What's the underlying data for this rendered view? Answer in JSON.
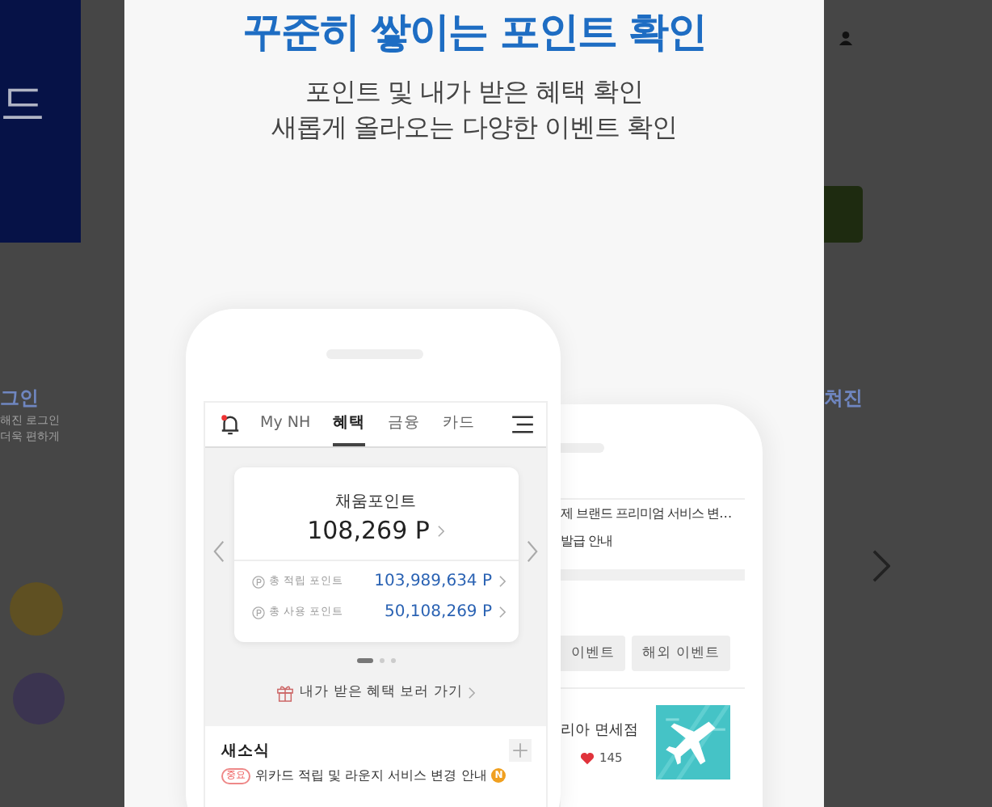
{
  "background_page": {
    "banner_text": "드",
    "left_heading": "그인",
    "left_lines": [
      "해진 로그인",
      "더욱 편하게"
    ],
    "right_heading": "쳐진"
  },
  "modal": {
    "title": "꾸준히 쌓이는 포인트 확인",
    "subtitle_lines": [
      "포인트 및 내가 받은 혜택 확인",
      "새롭게 올라오는 다양한 이벤트 확인"
    ]
  },
  "front_phone": {
    "nav_tabs": [
      {
        "label": "My NH",
        "selected": false
      },
      {
        "label": "혜택",
        "selected": true
      },
      {
        "label": "금융",
        "selected": false
      },
      {
        "label": "카드",
        "selected": false
      }
    ],
    "points": {
      "title": "채움포인트",
      "total": "108,269 P",
      "rows": [
        {
          "label": "총 적립 포인트",
          "value": "103,989,634 P"
        },
        {
          "label": "총 사용 포인트",
          "value": "50,108,269 P"
        }
      ]
    },
    "carousel_pages": [
      {
        "selected": true
      },
      {
        "selected": false
      },
      {
        "selected": false
      }
    ],
    "benefits_link": "내가 받은 혜택 보러 가기",
    "news": {
      "title": "새소식",
      "items": [
        {
          "tag": "중요",
          "text": "위카드 적립 및 라운지 서비스 변경 안내",
          "badge": "N"
        }
      ]
    }
  },
  "back_phone": {
    "notices": [
      "제 브랜드 프리미엄 서비스 변…",
      "발급 안내"
    ],
    "event_tabs": [
      "이벤트",
      "해외 이벤트"
    ],
    "event": {
      "title": "리아 면세점",
      "likes": "145"
    }
  }
}
